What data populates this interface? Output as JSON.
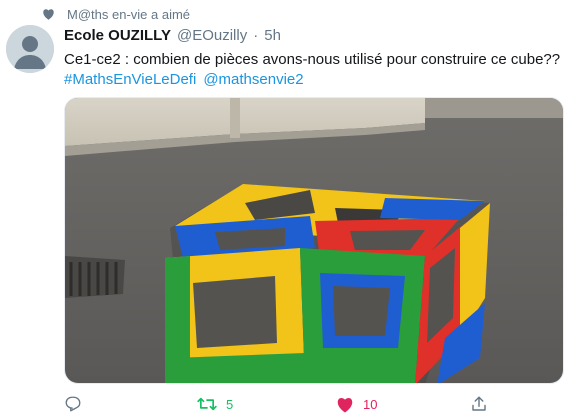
{
  "social_context": {
    "icon": "heart-icon",
    "text": "M@ths en-vie a aimé"
  },
  "tweet": {
    "display_name": "Ecole OUZILLY",
    "handle": "@EOuzilly",
    "separator": "·",
    "time": "5h",
    "text": "Ce1-ce2 : combien de pièces avons-nous utilisé pour construire ce cube??",
    "hashtag": "#MathsEnVieLeDefi",
    "mention": "@mathsenvie2"
  },
  "actions": {
    "reply_count": "",
    "retweet_count": "5",
    "like_count": "10",
    "icons": [
      "reply-icon",
      "retweet-icon",
      "heart-icon",
      "share-icon"
    ]
  },
  "colors": {
    "link": "#1b95e0",
    "muted": "#657786",
    "retweeted": "#17bf63",
    "liked": "#e0245e"
  }
}
